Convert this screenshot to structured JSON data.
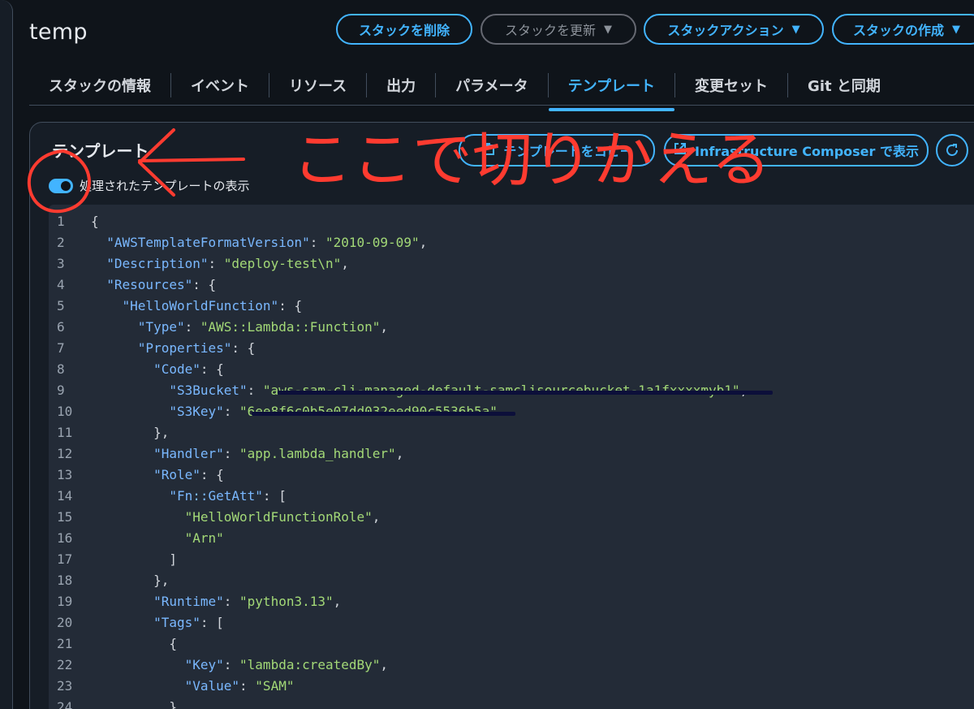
{
  "stack": {
    "name": "temp"
  },
  "actions": {
    "delete": "スタックを削除",
    "update": "スタックを更新",
    "stack_actions": "スタックアクション",
    "create": "スタックの作成",
    "caret": "▼"
  },
  "tabs": [
    {
      "label": "スタックの情報"
    },
    {
      "label": "イベント"
    },
    {
      "label": "リソース"
    },
    {
      "label": "出力"
    },
    {
      "label": "パラメータ"
    },
    {
      "label": "テンプレート",
      "active": true
    },
    {
      "label": "変更セット"
    },
    {
      "label": "Git と同期"
    }
  ],
  "panel": {
    "title": "テンプレート",
    "copy_button": "テンプレートをコピー",
    "composer_button": "Infrastructure Composer で表示",
    "toggle_label": "処理されたテンプレートの表示",
    "refresh_icon": "refresh-icon"
  },
  "code_lines": [
    [
      "1",
      "{"
    ],
    [
      "2",
      "  \"AWSTemplateFormatVersion\": \"2010-09-09\","
    ],
    [
      "3",
      "  \"Description\": \"deploy-test\\n\","
    ],
    [
      "4",
      "  \"Resources\": {"
    ],
    [
      "5",
      "    \"HelloWorldFunction\": {"
    ],
    [
      "6",
      "      \"Type\": \"AWS::Lambda::Function\","
    ],
    [
      "7",
      "      \"Properties\": {"
    ],
    [
      "8",
      "        \"Code\": {"
    ],
    [
      "9",
      "          \"S3Bucket\": \"aws-sam-cli-managed-default-samclisourcebucket-1a1fxxxxmyb1\","
    ],
    [
      "10",
      "          \"S3Key\": \"6ee8f6c0b5e07dd032eed90c5536b5a\""
    ],
    [
      "11",
      "        },"
    ],
    [
      "12",
      "        \"Handler\": \"app.lambda_handler\","
    ],
    [
      "13",
      "        \"Role\": {"
    ],
    [
      "14",
      "          \"Fn::GetAtt\": ["
    ],
    [
      "15",
      "            \"HelloWorldFunctionRole\","
    ],
    [
      "16",
      "            \"Arn\""
    ],
    [
      "17",
      "          ]"
    ],
    [
      "18",
      "        },"
    ],
    [
      "19",
      "        \"Runtime\": \"python3.13\","
    ],
    [
      "20",
      "        \"Tags\": ["
    ],
    [
      "21",
      "          {"
    ],
    [
      "22",
      "            \"Key\": \"lambda:createdBy\","
    ],
    [
      "23",
      "            \"Value\": \"SAM\""
    ],
    [
      "24",
      "          }"
    ]
  ],
  "annotation": {
    "text": "ここで切りかえる",
    "color": "#ff3b30"
  }
}
